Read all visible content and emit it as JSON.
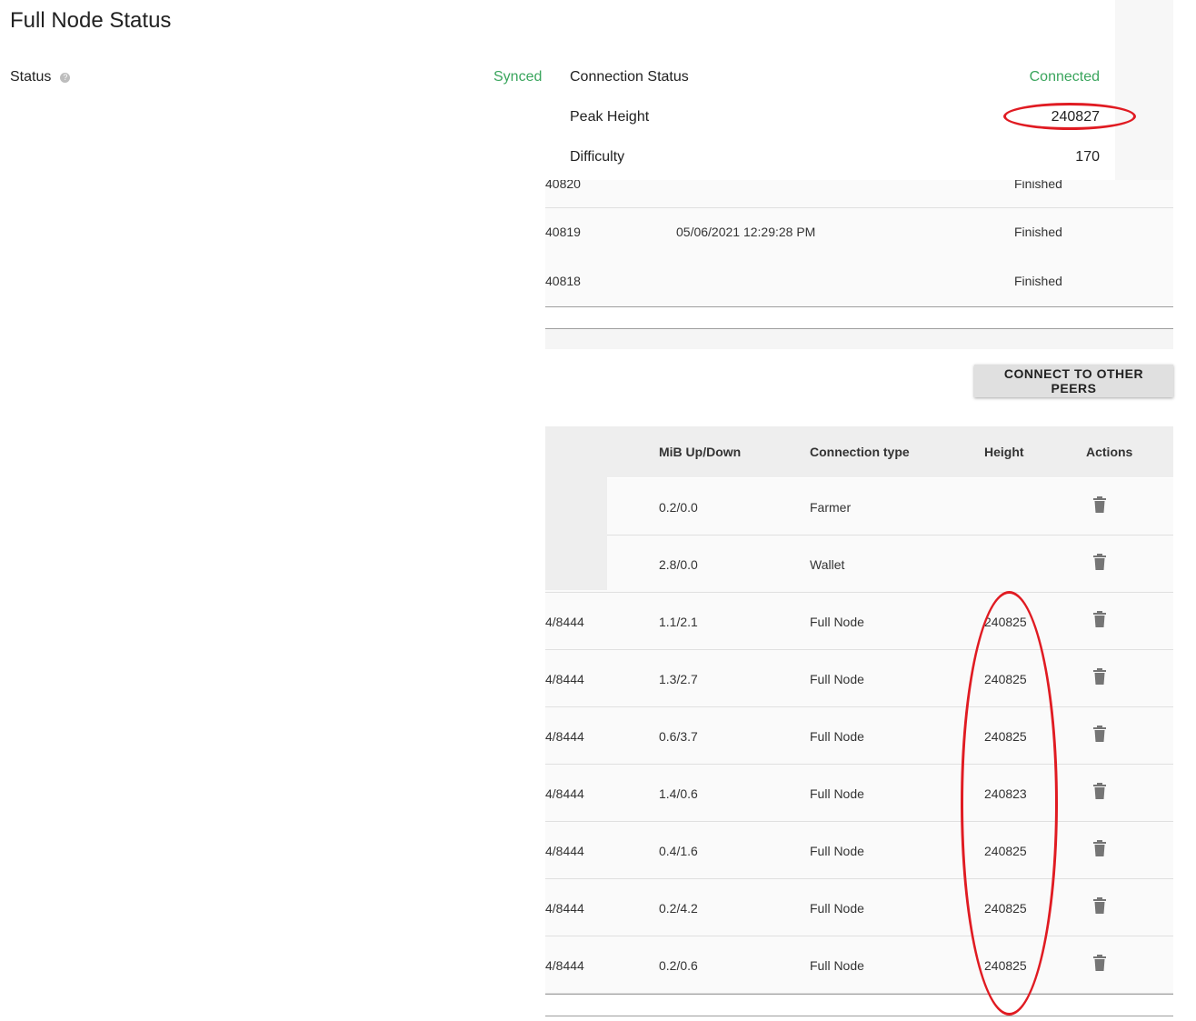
{
  "page": {
    "title": "Full Node Status",
    "status_label": "Status",
    "status_value": "Synced"
  },
  "card": {
    "rows": [
      {
        "label": "Connection Status",
        "value": "Connected"
      },
      {
        "label": "Peak Height",
        "value": "240827"
      },
      {
        "label": "Difficulty",
        "value": "170"
      }
    ]
  },
  "blocks": [
    {
      "height": "40820",
      "time": "",
      "state": "Finished"
    },
    {
      "height": "40819",
      "time": "05/06/2021 12:29:28 PM",
      "state": "Finished"
    },
    {
      "height": "40818",
      "time": "",
      "state": "Finished"
    }
  ],
  "connect_button": "CONNECT TO OTHER PEERS",
  "connections": {
    "headers": {
      "mib": "MiB Up/Down",
      "type": "Connection type",
      "height": "Height",
      "actions": "Actions"
    },
    "rows": [
      {
        "ip": "",
        "mib": "0.2/0.0",
        "type": "Farmer",
        "height": ""
      },
      {
        "ip": "",
        "mib": "2.8/0.0",
        "type": "Wallet",
        "height": ""
      },
      {
        "ip": "4/8444",
        "mib": "1.1/2.1",
        "type": "Full Node",
        "height": "240825"
      },
      {
        "ip": "4/8444",
        "mib": "1.3/2.7",
        "type": "Full Node",
        "height": "240825"
      },
      {
        "ip": "4/8444",
        "mib": "0.6/3.7",
        "type": "Full Node",
        "height": "240825"
      },
      {
        "ip": "4/8444",
        "mib": "1.4/0.6",
        "type": "Full Node",
        "height": "240823"
      },
      {
        "ip": "4/8444",
        "mib": "0.4/1.6",
        "type": "Full Node",
        "height": "240825"
      },
      {
        "ip": "4/8444",
        "mib": "0.2/4.2",
        "type": "Full Node",
        "height": "240825"
      },
      {
        "ip": "4/8444",
        "mib": "0.2/0.6",
        "type": "Full Node",
        "height": "240825"
      }
    ]
  },
  "colors": {
    "accent_green": "#3aa55d",
    "annotation_red": "#e01b22"
  },
  "icons": {
    "help": "help-circle-icon",
    "delete": "trash-icon"
  }
}
